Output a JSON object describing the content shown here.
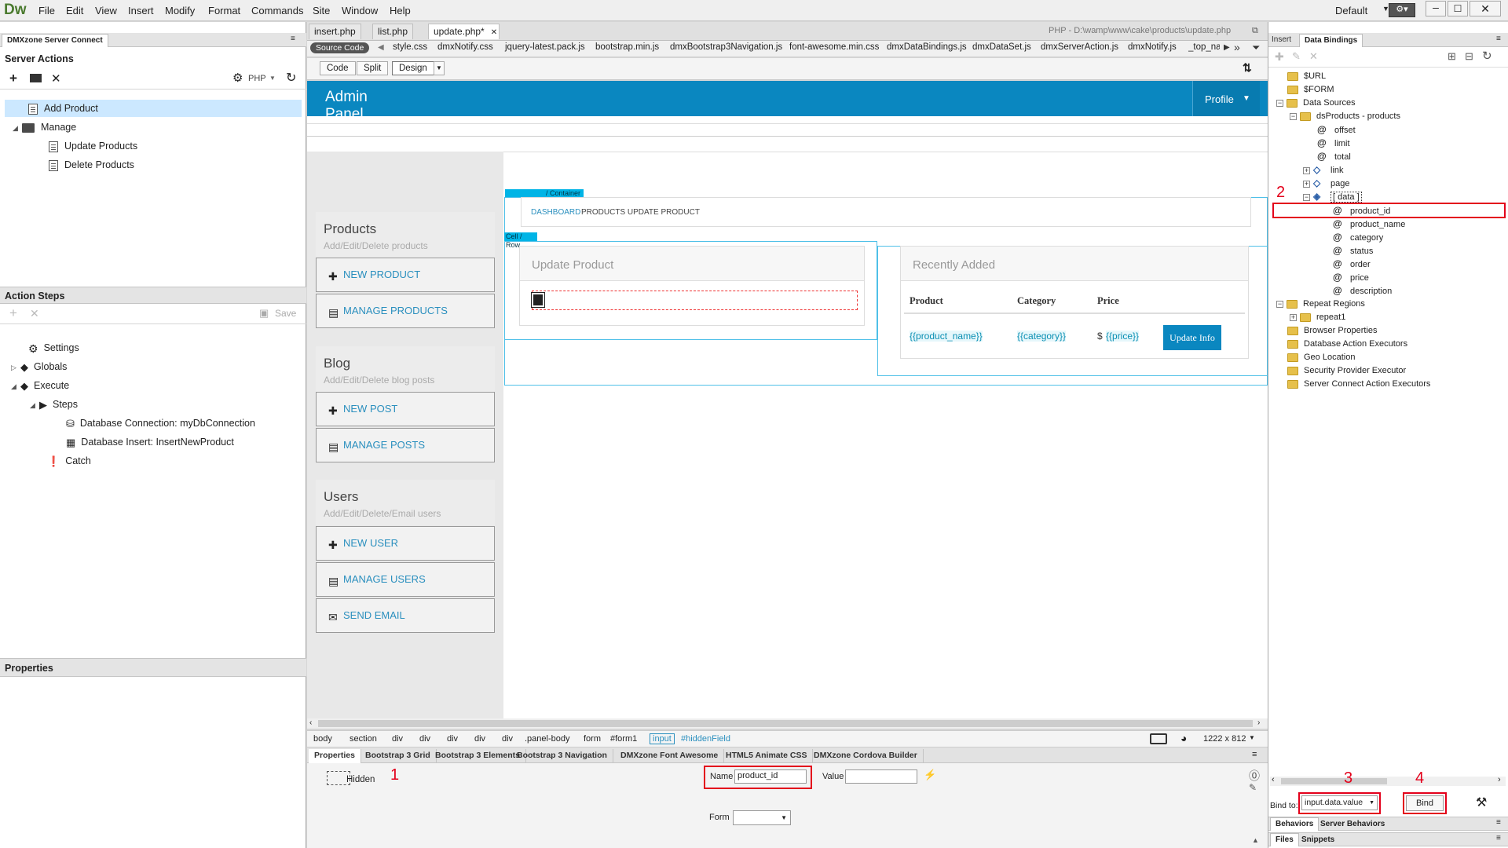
{
  "menubar": {
    "logo": "Dw",
    "items": [
      "File",
      "Edit",
      "View",
      "Insert",
      "Modify",
      "Format",
      "Commands",
      "Site",
      "Window",
      "Help"
    ],
    "workspace": "Default"
  },
  "left_panel": {
    "tab": "DMXzone Server Connect",
    "server_actions_title": "Server Actions",
    "php_label": "PHP",
    "actions": [
      {
        "label": "Add Product"
      },
      {
        "label": "Manage"
      },
      {
        "label": "Update Products"
      },
      {
        "label": "Delete Products"
      }
    ],
    "action_steps_title": "Action Steps",
    "save_label": "Save",
    "steps": [
      {
        "label": "Settings"
      },
      {
        "label": "Globals"
      },
      {
        "label": "Execute"
      },
      {
        "label": "Steps"
      },
      {
        "label": "Database Connection: myDbConnection"
      },
      {
        "label": "Database Insert: InsertNewProduct"
      },
      {
        "label": "Catch"
      }
    ],
    "properties_title": "Properties"
  },
  "doc_tabs": [
    "insert.php",
    "list.php",
    "update.php*"
  ],
  "doc_path": "PHP - D:\\wamp\\www\\cake\\products\\update.php",
  "source_bar": {
    "source_code": "Source Code",
    "files": [
      "style.css",
      "dmxNotify.css",
      "jquery-latest.pack.js",
      "bootstrap.min.js",
      "dmxBootstrap3Navigation.js",
      "font-awesome.min.css",
      "dmxDataBindings.js",
      "dmxDataSet.js",
      "dmxServerAction.js",
      "dmxNotify.js",
      "_top_na"
    ]
  },
  "view_buttons": {
    "code": "Code",
    "split": "Split",
    "design": "Design"
  },
  "design": {
    "header_title": "Admin Panel",
    "profile": "Profile",
    "container_label": "/ Container",
    "breadcrumb": {
      "dashboard": "DASHBOARD",
      "rest": "PRODUCTS UPDATE PRODUCT"
    },
    "cell_label": "Cell",
    "row_label": "/ Row",
    "update_product": "Update Product",
    "recently_added": "Recently Added",
    "table": {
      "headers": [
        "Product",
        "Category",
        "Price"
      ],
      "row": [
        "{{product_name}}",
        "{{category}}",
        "{{price}}"
      ],
      "currency": "$",
      "update_button": "Update Info"
    },
    "sidebar": [
      {
        "title": "Products",
        "subtitle": "Add/Edit/Delete products",
        "buttons": [
          "NEW PRODUCT",
          "MANAGE PRODUCTS"
        ]
      },
      {
        "title": "Blog",
        "subtitle": "Add/Edit/Delete blog posts",
        "buttons": [
          "NEW POST",
          "MANAGE POSTS"
        ]
      },
      {
        "title": "Users",
        "subtitle": "Add/Edit/Delete/Email users",
        "buttons": [
          "NEW USER",
          "MANAGE USERS",
          "SEND EMAIL"
        ]
      }
    ]
  },
  "tag_selector": {
    "tags": [
      "body",
      "section",
      "div",
      "div",
      "div",
      "div",
      "div",
      ".panel-body",
      "form",
      "#form1",
      "input",
      "#hiddenField"
    ],
    "size": "1222 x 812"
  },
  "properties": {
    "tabs": [
      "Properties",
      "Bootstrap 3 Grid",
      "Bootstrap 3 Elements",
      "Bootstrap 3 Navigation",
      "DMXzone Font Awesome",
      "HTML5 Animate CSS",
      "DMXzone Cordova Builder"
    ],
    "hidden_label": "Hidden",
    "name_label": "Name",
    "name_value": "product_id",
    "value_label": "Value",
    "form_label": "Form"
  },
  "right_panel": {
    "tabs": [
      "Insert",
      "Data Bindings"
    ],
    "tree": [
      "$URL",
      "$FORM",
      "Data Sources",
      "dsProducts - products",
      "offset",
      "limit",
      "total",
      "link",
      "page",
      "[ data ]",
      "product_id",
      "product_name",
      "category",
      "status",
      "order",
      "price",
      "description",
      "Repeat Regions",
      "repeat1",
      "Browser Properties",
      "Database Action Executors",
      "Geo Location",
      "Security Provider Executor",
      "Server Connect Action Executors"
    ],
    "bind_to_label": "Bind to:",
    "bind_to_value": "input.data.value",
    "bind_button": "Bind",
    "bottom_tabs_1": [
      "Behaviors",
      "Server Behaviors"
    ],
    "bottom_tabs_2": [
      "Files",
      "Snippets"
    ]
  },
  "annotations": [
    "1",
    "2",
    "3",
    "4"
  ],
  "colors": {
    "header": "#0a87c0",
    "link": "#2a8fbe",
    "annotation": "#e3001b",
    "selection": "#cce8ff"
  }
}
